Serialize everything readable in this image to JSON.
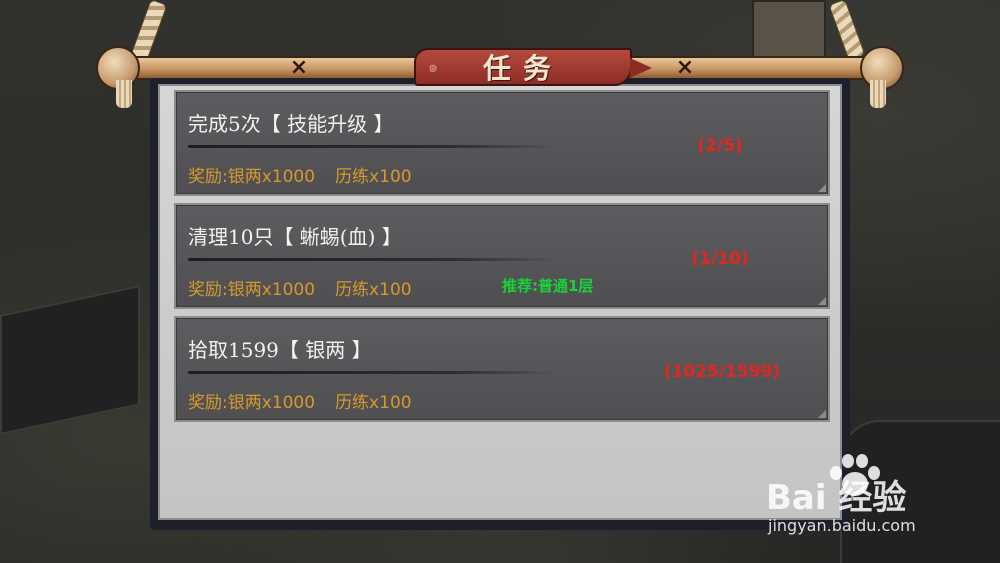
{
  "window": {
    "title": "任务"
  },
  "tasks": [
    {
      "name": "完成5次【 技能升级 】",
      "reward_label": "奖励:",
      "reward_silver": "银两x1000",
      "reward_exp": "历练x100",
      "progress": "(2/5)",
      "recommend": ""
    },
    {
      "name": "清理10只【 蜥蜴(血) 】",
      "reward_label": "奖励:",
      "reward_silver": "银两x1000",
      "reward_exp": "历练x100",
      "progress": "(1/10)",
      "recommend": "推荐:普通1层"
    },
    {
      "name": "拾取1599【 银两 】",
      "reward_label": "奖励:",
      "reward_silver": "银两x1000",
      "reward_exp": "历练x100",
      "progress": "(1025/1599)",
      "recommend": ""
    }
  ],
  "watermark": {
    "brand": "Bai 经验",
    "url": "jingyan.baidu.com"
  },
  "colors": {
    "title_banner": "#9c3a30",
    "reward_text": "#d69a2a",
    "progress_text": "#e3261f",
    "recommend_text": "#19d23a",
    "card_bg": "#58585b"
  },
  "icons": [
    "scroll-rod-icon",
    "rope-icon",
    "paw-logo-icon"
  ]
}
